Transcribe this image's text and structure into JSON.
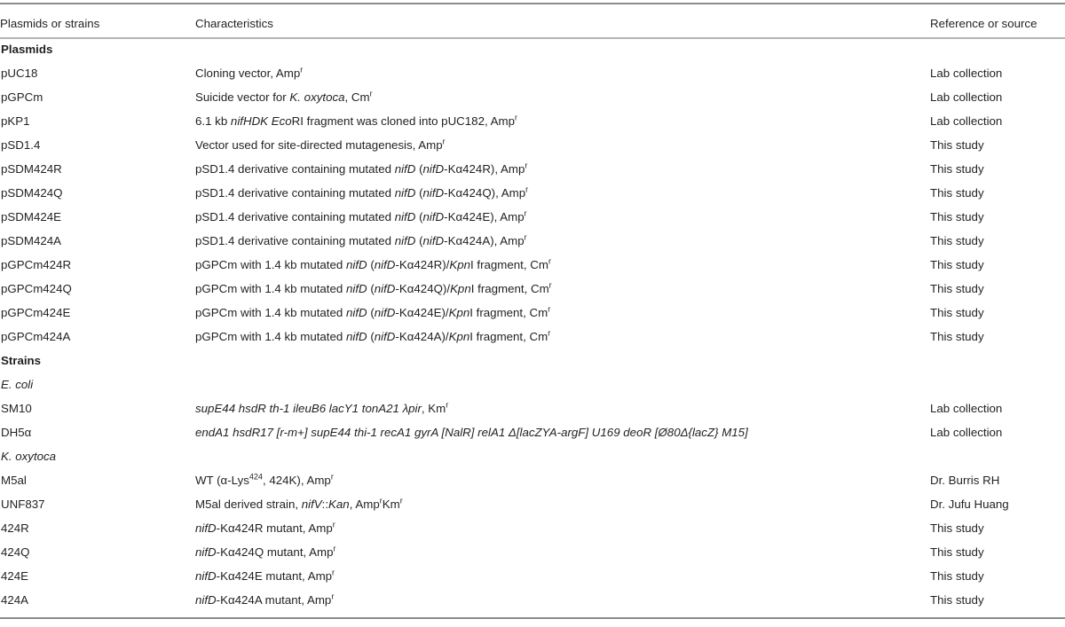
{
  "table": {
    "columns": [
      "Plasmids or strains",
      "Characteristics",
      "Reference or source"
    ],
    "sections": [
      {
        "heading": "Plasmids",
        "heading_style": "bold",
        "rows": [
          {
            "name": "pUC18",
            "characteristics": "Cloning vector, Amp<sup>r</sup>",
            "reference": "Lab collection"
          },
          {
            "name": "pGPCm",
            "characteristics": "Suicide vector for <i>K. oxytoca</i>, Cm<sup>r</sup>",
            "reference": "Lab collection"
          },
          {
            "name": "pKP1",
            "characteristics": "6.1 kb <i>nifHDK</i> <i>Eco</i>RI fragment was cloned into pUC182, Amp<sup>r</sup>",
            "reference": "Lab collection"
          },
          {
            "name": "pSD1.4",
            "characteristics": "Vector used for site-directed mutagenesis, Amp<sup>r</sup>",
            "reference": "This study"
          },
          {
            "name": "pSDM424R",
            "characteristics": "pSD1.4 derivative containing mutated <i>nifD</i> (<i>nifD</i>-K&alpha;424R), Amp<sup>r</sup>",
            "reference": "This study"
          },
          {
            "name": "pSDM424Q",
            "characteristics": "pSD1.4 derivative containing mutated <i>nifD</i> (<i>nifD</i>-K&alpha;424Q), Amp<sup>r</sup>",
            "reference": "This study"
          },
          {
            "name": "pSDM424E",
            "characteristics": "pSD1.4 derivative containing mutated <i>nifD</i> (<i>nifD</i>-K&alpha;424E), Amp<sup>r</sup>",
            "reference": "This study"
          },
          {
            "name": "pSDM424A",
            "characteristics": "pSD1.4 derivative containing mutated <i>nifD</i> (<i>nifD</i>-K&alpha;424A), Amp<sup>r</sup>",
            "reference": "This study"
          },
          {
            "name": "pGPCm424R",
            "characteristics": "pGPCm with 1.4 kb mutated <i>nifD</i> (<i>nifD</i>-K&alpha;424R)/<i>Kpn</i>I fragment, Cm<sup>r</sup>",
            "reference": "This study"
          },
          {
            "name": "pGPCm424Q",
            "characteristics": "pGPCm with 1.4 kb mutated <i>nifD</i> (<i>nifD</i>-K&alpha;424Q)/<i>Kpn</i>I fragment, Cm<sup>r</sup>",
            "reference": "This study"
          },
          {
            "name": "pGPCm424E",
            "characteristics": "pGPCm with 1.4 kb mutated <i>nifD</i> (<i>nifD</i>-K&alpha;424E)/<i>Kpn</i>I fragment, Cm<sup>r</sup>",
            "reference": "This study"
          },
          {
            "name": "pGPCm424A",
            "characteristics": "pGPCm with 1.4 kb mutated <i>nifD</i> (<i>nifD</i>-K&alpha;424A)/<i>Kpn</i>I fragment, Cm<sup>r</sup>",
            "reference": "This study"
          }
        ]
      },
      {
        "heading": "Strains",
        "heading_style": "bold",
        "subsections": [
          {
            "heading": "E. coli",
            "heading_style": "italic",
            "rows": [
              {
                "name": "SM10",
                "characteristics": "<i>supE44 hsdR th-1 ileuB6 lacY1 tonA21 &lambda;pir</i>, Km<sup>r</sup>",
                "reference": "Lab collection"
              },
              {
                "name": "DH5&alpha;",
                "characteristics": "<i>endA1 hsdR17 [r-m+] supE44 thi-1 recA1 gyrA [NalR] relA1 &Delta;[lacZYA-argF] U169 deoR [&Oslash;80&Delta;{lacZ} M15]</i>",
                "reference": "Lab collection"
              }
            ]
          },
          {
            "heading": "K. oxytoca",
            "heading_style": "italic",
            "rows": [
              {
                "name": "M5al",
                "characteristics": "WT (&alpha;-Lys<sup>424</sup>, 424K), Amp<sup>r</sup>",
                "reference": "Dr. Burris RH"
              },
              {
                "name": "UNF837",
                "characteristics": "M5al derived strain, <i>nifV</i>::<i>Kan</i>, Amp<sup>r</sup>Km<sup>r</sup>",
                "reference": "Dr. Jufu Huang"
              },
              {
                "name": "424R",
                "characteristics": "<i>nifD</i>-K&alpha;424R mutant, Amp<sup>r</sup>",
                "reference": "This study"
              },
              {
                "name": "424Q",
                "characteristics": "<i>nifD</i>-K&alpha;424Q mutant, Amp<sup>r</sup>",
                "reference": "This study"
              },
              {
                "name": "424E",
                "characteristics": "<i>nifD</i>-K&alpha;424E mutant, Amp<sup>r</sup>",
                "reference": "This study"
              },
              {
                "name": "424A",
                "characteristics": "<i>nifD</i>-K&alpha;424A mutant, Amp<sup>r</sup>",
                "reference": "This study"
              }
            ]
          }
        ]
      }
    ]
  },
  "colors": {
    "text": "#231f20",
    "rule_strong": "#8c8c8c",
    "rule_light": "#b4b4b4",
    "background": "#ffffff"
  }
}
